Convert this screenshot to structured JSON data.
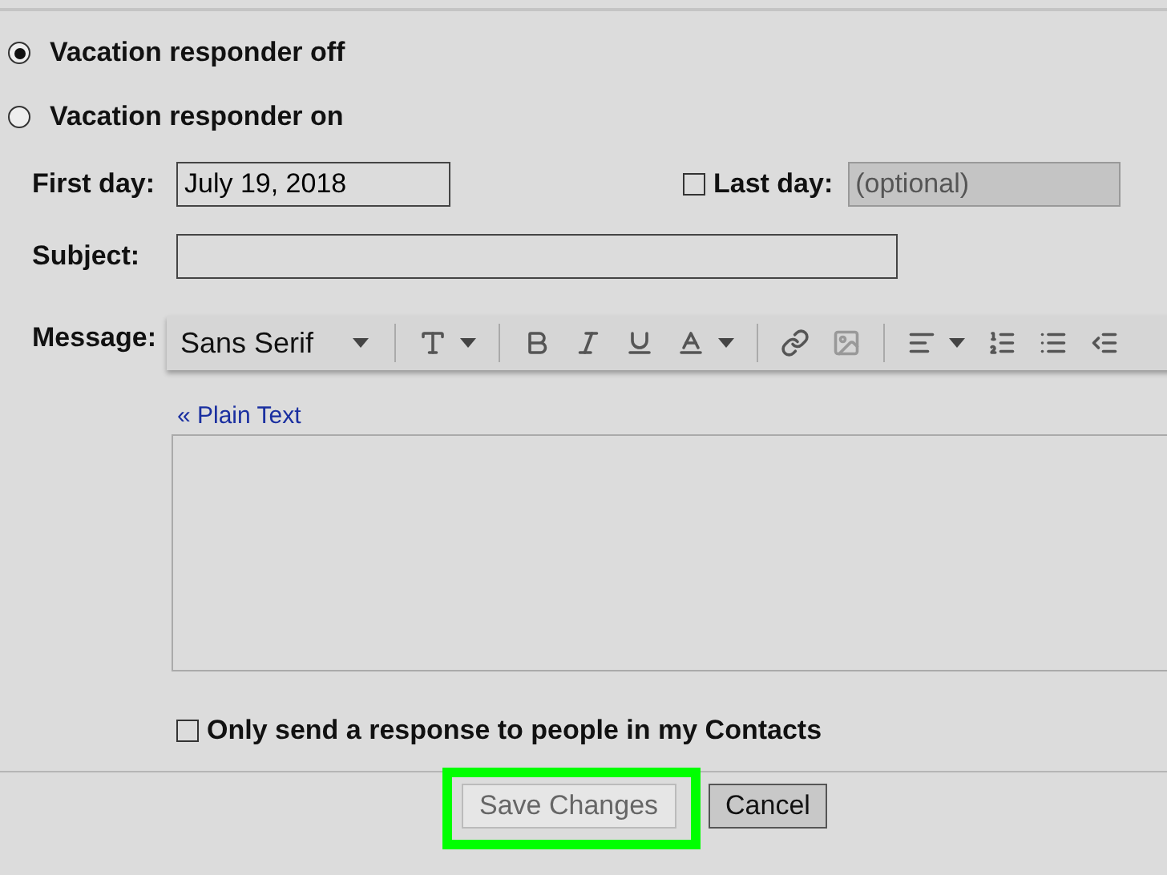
{
  "responder": [
    {
      "label": "Vacation responder off",
      "selected": true
    },
    {
      "label": "Vacation responder on",
      "selected": false
    }
  ],
  "first_day": {
    "label": "First day:",
    "value": "July 19, 2018"
  },
  "last_day": {
    "label": "Last day:",
    "checked": false,
    "placeholder": "(optional)",
    "disabled": true
  },
  "subject": {
    "label": "Subject:"
  },
  "message": {
    "label": "Message:",
    "font": "Sans Serif",
    "plain_text_link": "« Plain Text"
  },
  "contacts_only": {
    "label": "Only send a response to people in my Contacts",
    "checked": false
  },
  "buttons": [
    {
      "label": "Save Changes",
      "disabled": true,
      "highlighted": true
    },
    {
      "label": "Cancel",
      "disabled": false,
      "highlighted": false
    }
  ]
}
